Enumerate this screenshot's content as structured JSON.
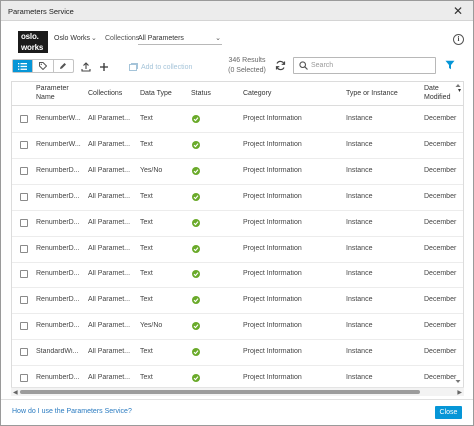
{
  "window": {
    "title": "Parameters Service"
  },
  "header": {
    "logo_line1": "oslo.",
    "logo_line2": "works",
    "workspace": "Oslo Works",
    "collections_label": "Collections",
    "collections_value": "All Parameters"
  },
  "toolbar": {
    "add_to_collection": "Add to collection",
    "results_line1": "346 Results",
    "results_line2": "(0 Selected)",
    "search_placeholder": "Search"
  },
  "table": {
    "columns": [
      "Parameter Name",
      "Collections",
      "Data Type",
      "Status",
      "Category",
      "Type or Instance",
      "Date Modified"
    ],
    "rows": [
      {
        "name": "RenumberW...",
        "collections": "All Paramet...",
        "data_type": "Text",
        "status": "ok",
        "category": "Project Information",
        "type_or_instance": "Instance",
        "date_modified": "December"
      },
      {
        "name": "RenumberW...",
        "collections": "All Paramet...",
        "data_type": "Text",
        "status": "ok",
        "category": "Project Information",
        "type_or_instance": "Instance",
        "date_modified": "December"
      },
      {
        "name": "RenumberD...",
        "collections": "All Paramet...",
        "data_type": "Yes/No",
        "status": "ok",
        "category": "Project Information",
        "type_or_instance": "Instance",
        "date_modified": "December"
      },
      {
        "name": "RenumberD...",
        "collections": "All Paramet...",
        "data_type": "Text",
        "status": "ok",
        "category": "Project Information",
        "type_or_instance": "Instance",
        "date_modified": "December"
      },
      {
        "name": "RenumberD...",
        "collections": "All Paramet...",
        "data_type": "Text",
        "status": "ok",
        "category": "Project Information",
        "type_or_instance": "Instance",
        "date_modified": "December"
      },
      {
        "name": "RenumberD...",
        "collections": "All Paramet...",
        "data_type": "Text",
        "status": "ok",
        "category": "Project Information",
        "type_or_instance": "Instance",
        "date_modified": "December"
      },
      {
        "name": "RenumberD...",
        "collections": "All Paramet...",
        "data_type": "Text",
        "status": "ok",
        "category": "Project Information",
        "type_or_instance": "Instance",
        "date_modified": "December"
      },
      {
        "name": "RenumberD...",
        "collections": "All Paramet...",
        "data_type": "Text",
        "status": "ok",
        "category": "Project Information",
        "type_or_instance": "Instance",
        "date_modified": "December"
      },
      {
        "name": "RenumberD...",
        "collections": "All Paramet...",
        "data_type": "Yes/No",
        "status": "ok",
        "category": "Project Information",
        "type_or_instance": "Instance",
        "date_modified": "December"
      },
      {
        "name": "StandardWi...",
        "collections": "All Paramet...",
        "data_type": "Text",
        "status": "ok",
        "category": "Project Information",
        "type_or_instance": "Instance",
        "date_modified": "December"
      },
      {
        "name": "RenumberD...",
        "collections": "All Paramet...",
        "data_type": "Text",
        "status": "ok",
        "category": "Project Information",
        "type_or_instance": "Instance",
        "date_modified": "December"
      }
    ]
  },
  "footer": {
    "help_link": "How do I use the Parameters Service?",
    "close_label": "Close"
  },
  "colors": {
    "accent": "#0696d7",
    "status_ok": "#6aaa2a",
    "link": "#2a7bc0"
  }
}
